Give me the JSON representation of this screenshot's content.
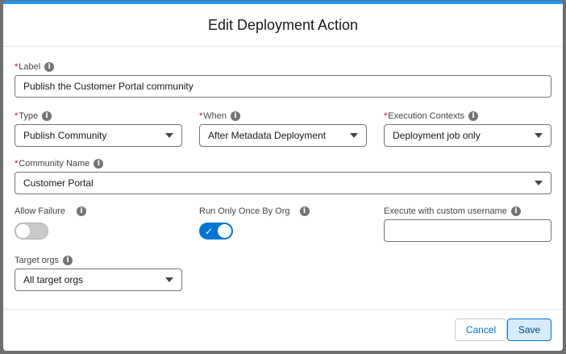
{
  "modal": {
    "title": "Edit Deployment Action"
  },
  "fields": {
    "label": {
      "label": "Label",
      "value": "Publish the Customer Portal community"
    },
    "type": {
      "label": "Type",
      "value": "Publish Community"
    },
    "when": {
      "label": "When",
      "value": "After Metadata Deployment"
    },
    "execution_contexts": {
      "label": "Execution Contexts",
      "value": "Deployment job only"
    },
    "community_name": {
      "label": "Community Name",
      "value": "Customer Portal"
    },
    "allow_failure": {
      "label": "Allow Failure",
      "checked": false
    },
    "run_only_once": {
      "label": "Run Only Once By Org",
      "checked": true
    },
    "custom_username": {
      "label": "Execute with custom username",
      "value": ""
    },
    "target_orgs": {
      "label": "Target orgs",
      "value": "All target orgs"
    }
  },
  "required_marker": "*",
  "info_glyph": "i",
  "check_glyph": "✓",
  "footer": {
    "cancel_label": "Cancel",
    "save_label": "Save"
  },
  "colors": {
    "accent": "#0176d3",
    "required": "#ba0517",
    "top_bar": "#1b96ff"
  }
}
